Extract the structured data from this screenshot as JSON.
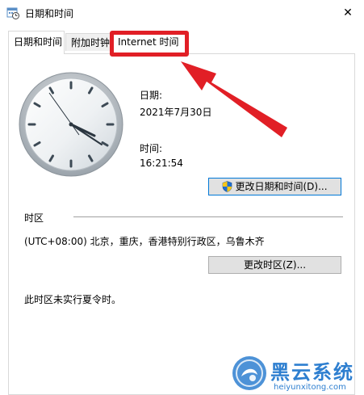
{
  "window": {
    "title": "日期和时间",
    "close_glyph": "✕"
  },
  "tabs": [
    {
      "label": "日期和时间",
      "active": true
    },
    {
      "label": "附加时钟",
      "active": false
    },
    {
      "label": "Internet 时间",
      "active": false
    }
  ],
  "datetime": {
    "date_label": "日期:",
    "date_value": "2021年7月30日",
    "time_label": "时间:",
    "time_value": "16:21:54",
    "change_button": "更改日期和时间(D)..."
  },
  "timezone": {
    "section_label": "时区",
    "value": "(UTC+08:00) 北京，重庆，香港特别行政区，乌鲁木齐",
    "change_button": "更改时区(Z)...",
    "dst_note": "此时区未实行夏令时。"
  },
  "watermark": {
    "text": "黑云系统",
    "url": "heiyunxitong.com"
  },
  "colors": {
    "highlight": "#e11f26",
    "accent": "#0078d7",
    "watermark": "#2e7fd0"
  },
  "icons": {
    "app": "calendar-clock-icon",
    "shield": "uac-shield-icon",
    "close": "close-icon"
  }
}
